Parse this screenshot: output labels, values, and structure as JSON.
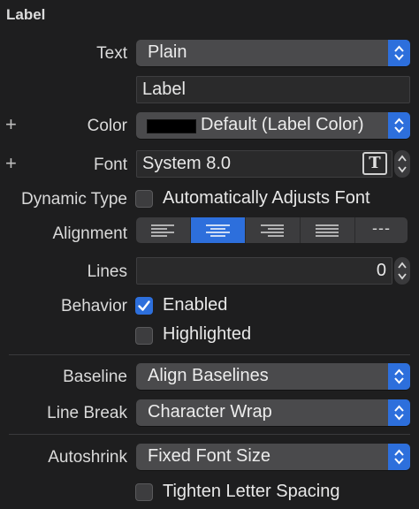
{
  "section_title": "Label",
  "text": {
    "label": "Text",
    "value": "Plain",
    "content": "Label"
  },
  "color": {
    "label": "Color",
    "value": "Default (Label Color)",
    "swatch": "#000000"
  },
  "font": {
    "label": "Font",
    "value": "System 8.0",
    "picker_icon": "T"
  },
  "dynamic_type": {
    "label": "Dynamic Type",
    "checkbox_label": "Automatically Adjusts Font",
    "checked": false
  },
  "alignment": {
    "label": "Alignment",
    "options": [
      "left-align-icon",
      "center-align-icon",
      "right-align-icon",
      "justify-align-icon",
      "natural-align-icon"
    ],
    "selected_index": 1,
    "natural_glyph": "---"
  },
  "lines": {
    "label": "Lines",
    "value": "0"
  },
  "behavior": {
    "label": "Behavior",
    "enabled_label": "Enabled",
    "enabled_checked": true,
    "highlighted_label": "Highlighted",
    "highlighted_checked": false
  },
  "baseline": {
    "label": "Baseline",
    "value": "Align Baselines"
  },
  "line_break": {
    "label": "Line Break",
    "value": "Character Wrap"
  },
  "autoshrink": {
    "label": "Autoshrink",
    "value": "Fixed Font Size",
    "tighten_label": "Tighten Letter Spacing",
    "tighten_checked": false
  },
  "colors": {
    "accent": "#2d6fdc",
    "background": "#1e1e1f",
    "control": "#4a4a4c"
  }
}
